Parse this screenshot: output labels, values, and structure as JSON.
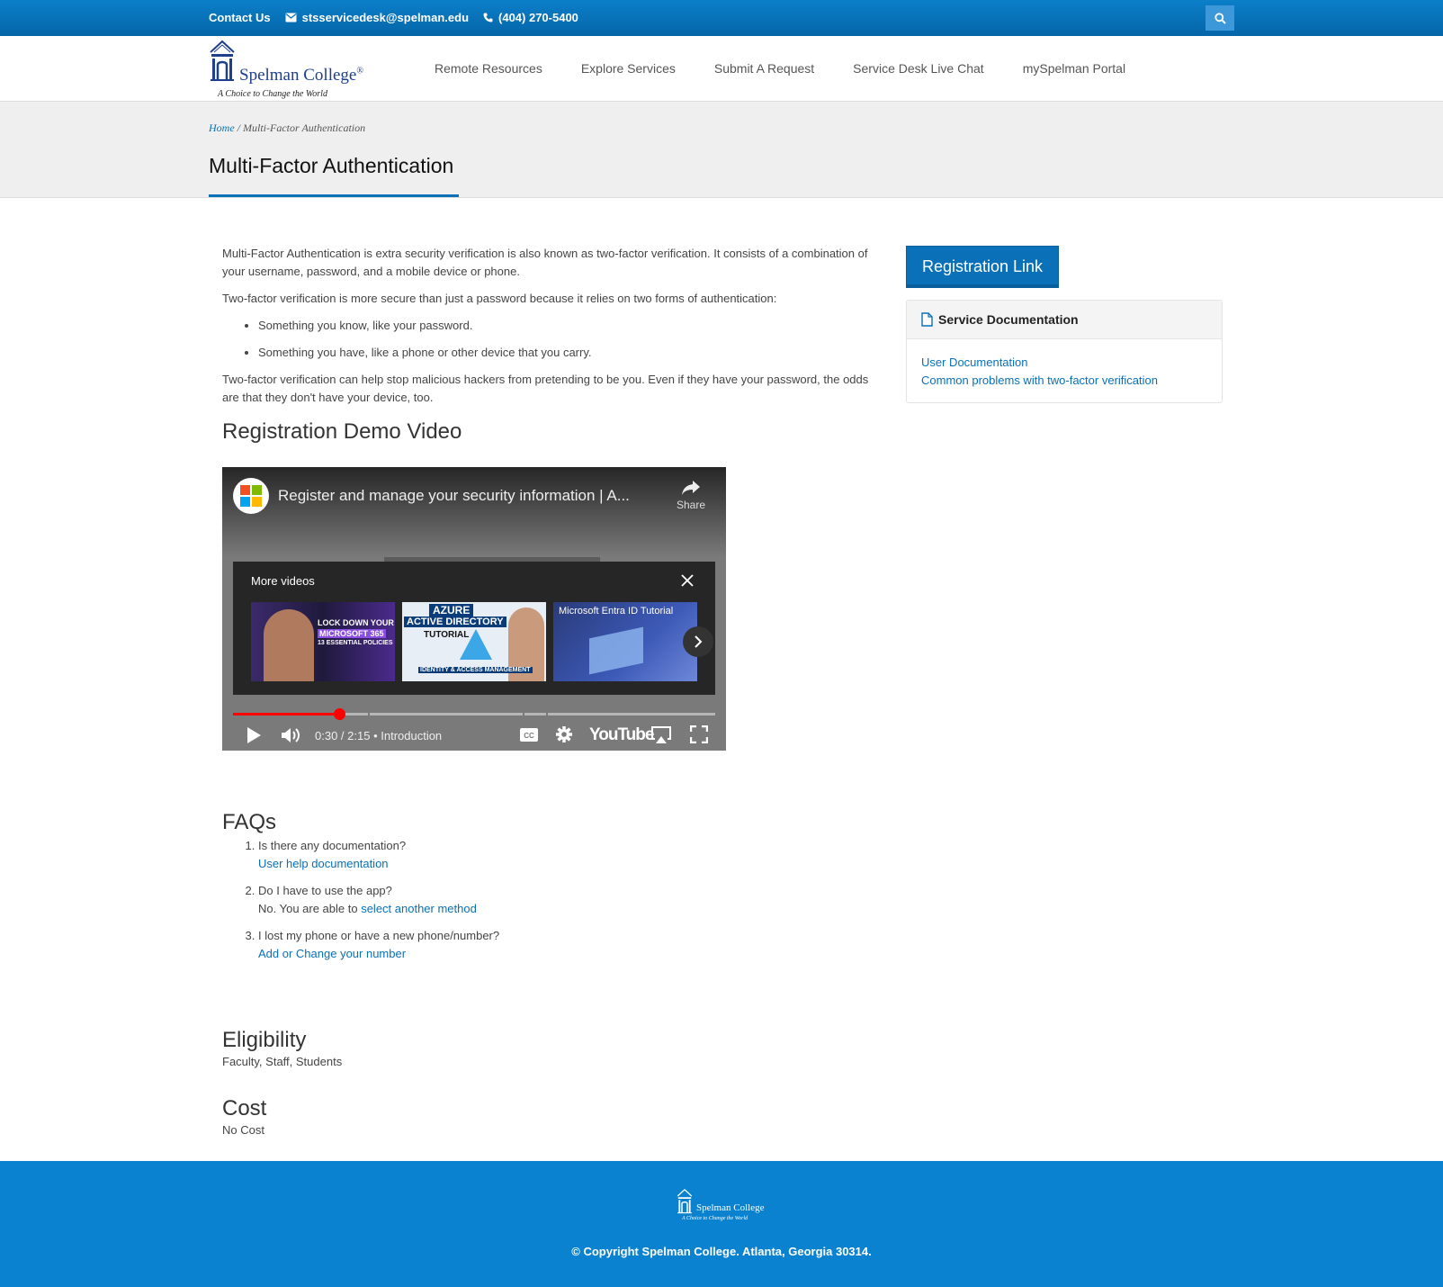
{
  "topbar": {
    "contact_label": "Contact Us",
    "email": "stsservicedesk@spelman.edu",
    "phone": "(404) 270-5400",
    "icons": [
      "envelope-icon",
      "phone-icon",
      "search-icon"
    ]
  },
  "header": {
    "logo_name": "Spelman College",
    "logo_mark": "®",
    "logo_tagline": "A Choice to Change the World",
    "nav": [
      "Remote Resources",
      "Explore Services",
      "Submit A Request",
      "Service Desk Live Chat",
      "mySpelman Portal"
    ]
  },
  "banner": {
    "breadcrumb_home": "Home",
    "breadcrumb_sep": " / ",
    "breadcrumb_current": "Multi-Factor Authentication",
    "title": "Multi-Factor Authentication"
  },
  "main": {
    "intro": "Multi-Factor Authentication is extra security verification is also known as two-factor verification. It consists of a combination of your username, password, and a mobile device or phone.",
    "two_factor": "Two-factor verification is more secure than just a password because it relies on two forms of authentication:",
    "bullets": [
      "Something you know, like your password.",
      "Something you have, like a phone or other device that you carry."
    ],
    "hackers": "Two-factor verification can help stop malicious hackers from pretending to be you. Even if they have your password, the odds are that they don't have your device, too.",
    "video_heading": "Registration Demo Video"
  },
  "video": {
    "title": "Register and manage your security information | A...",
    "share": "Share",
    "more_videos": "More videos",
    "thumbs": [
      {
        "line1": "LOCK DOWN YOUR",
        "line2": "MICROSOFT 365",
        "line3": "13 ESSENTIAL POLICIES"
      },
      {
        "line1": "AZURE",
        "line2": "ACTIVE DIRECTORY",
        "line3": "TUTORIAL",
        "line4": "IDENTITY & ACCESS MANAGEMENT"
      },
      {
        "line1": "Microsoft Entra ID Tutorial"
      }
    ],
    "time": "0:30 / 2:15",
    "chapter_sep": " • ",
    "chapter": "Introduction",
    "progress": 0.22,
    "brand": "YouTube"
  },
  "faq": {
    "heading": "FAQs",
    "items": [
      {
        "q": "Is there any documentation?",
        "a_prefix": "",
        "a_link": "User help documentation"
      },
      {
        "q": "Do I have to use the app?",
        "a_prefix": "No. You are able to ",
        "a_link": "select another method"
      },
      {
        "q": "I lost my phone or have a new phone/number?",
        "a_prefix": "",
        "a_link": "Add or Change your number"
      }
    ]
  },
  "eligibility": {
    "heading": "Eligibility",
    "text": "Faculty, Staff, Students"
  },
  "cost": {
    "heading": "Cost",
    "text": "No Cost"
  },
  "sidebar": {
    "button": "Registration Link",
    "panel_title": "Service Documentation",
    "links": [
      "User Documentation",
      "Common problems with two-factor verification"
    ]
  },
  "footer": {
    "logo_name": "Spelman College",
    "logo_tagline": "A Choice to Change the World",
    "copyright": "© Copyright Spelman College. Atlanta, Georgia 30314."
  },
  "colors": {
    "brand_blue": "#0a70b8",
    "footer_blue": "#0a82d0",
    "progress_red": "#ff0000"
  }
}
